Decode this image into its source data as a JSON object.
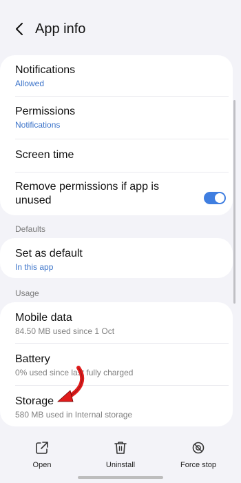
{
  "header": {
    "title": "App info"
  },
  "permissions_card": {
    "notifications": {
      "title": "Notifications",
      "subtitle": "Allowed"
    },
    "permissions": {
      "title": "Permissions",
      "subtitle": "Notifications"
    },
    "screen_time": {
      "title": "Screen time"
    },
    "remove_permissions": {
      "title_line1": "Remove permissions if app is",
      "title_line2": "unused",
      "enabled": true
    }
  },
  "defaults": {
    "label": "Defaults",
    "set_as_default": {
      "title": "Set as default",
      "subtitle": "In this app"
    }
  },
  "usage": {
    "label": "Usage",
    "mobile_data": {
      "title": "Mobile data",
      "subtitle": "84.50 MB used since 1 Oct"
    },
    "battery": {
      "title": "Battery",
      "subtitle": "0% used since last fully charged"
    },
    "storage": {
      "title": "Storage",
      "subtitle": "580 MB used in Internal storage"
    }
  },
  "bottom_bar": {
    "open_label": "Open",
    "uninstall_label": "Uninstall",
    "force_stop_label": "Force stop"
  },
  "colors": {
    "accent_blue": "#3b73c9",
    "toggle_on": "#3f7ee0",
    "annotation_arrow": "#e01b1b"
  },
  "icons": {
    "back": "back-chevron-icon",
    "open": "open-external-icon",
    "uninstall": "trash-icon",
    "force_stop": "stop-circle-icon"
  }
}
